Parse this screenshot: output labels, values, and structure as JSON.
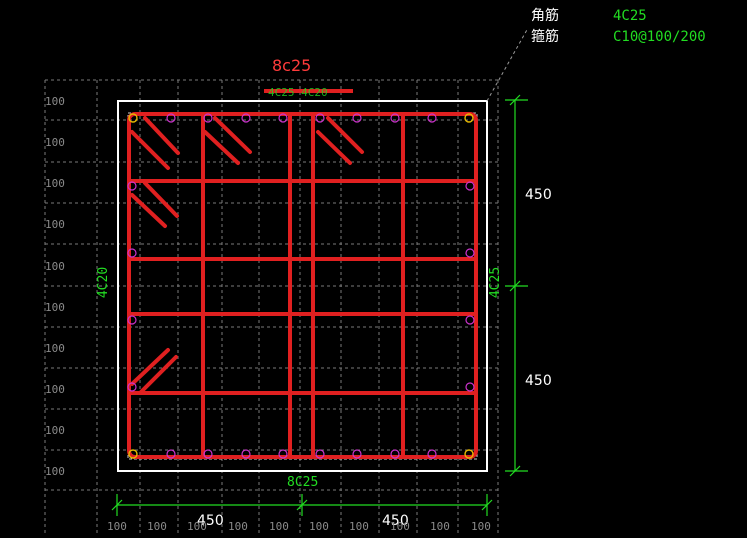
{
  "legend": {
    "corner_label": "角筋",
    "corner_value": "4C25",
    "stirrup_label": "箍筋",
    "stirrup_value": "C10@100/200"
  },
  "top_rebar_label": "8c25",
  "top_rebar_overlap": "4C25 4C20",
  "bottom_rebar_label": "8C25",
  "left_side_label": "4C20",
  "right_side_label": "4C25",
  "dimensions": {
    "bottom": [
      "450",
      "450"
    ],
    "right": [
      "450",
      "450"
    ],
    "grid_spacing": "100"
  },
  "colors": {
    "background": "#000000",
    "rebar": "#e02020",
    "outline": "#ffffff",
    "dimension": "#22dd22",
    "bar_marker": "#cc33cc",
    "corner_marker": "#e6b800",
    "grid": "#7a7a7a"
  }
}
